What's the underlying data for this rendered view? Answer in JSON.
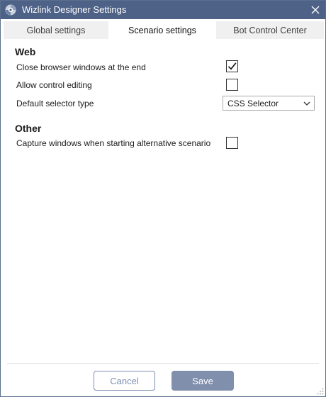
{
  "window": {
    "title": "Wizlink Designer Settings",
    "app_icon": "wizlink-logo-icon",
    "close_icon": "close-icon"
  },
  "tabs": [
    {
      "label": "Global settings",
      "active": false
    },
    {
      "label": "Scenario settings",
      "active": true
    },
    {
      "label": "Bot Control Center",
      "active": false
    }
  ],
  "web": {
    "title": "Web",
    "close_browser": {
      "label": "Close browser windows at the end",
      "checked": true
    },
    "allow_editing": {
      "label": "Allow control editing",
      "checked": false
    },
    "selector_type": {
      "label": "Default selector type",
      "value": "CSS Selector"
    }
  },
  "other": {
    "title": "Other",
    "capture_windows": {
      "label": "Capture windows when starting alternative scenario",
      "checked": false
    }
  },
  "footer": {
    "cancel_label": "Cancel",
    "save_label": "Save"
  },
  "colors": {
    "titlebar": "#4e6287",
    "save_button": "#7f8fac",
    "cancel_border": "#7d8fb1"
  }
}
